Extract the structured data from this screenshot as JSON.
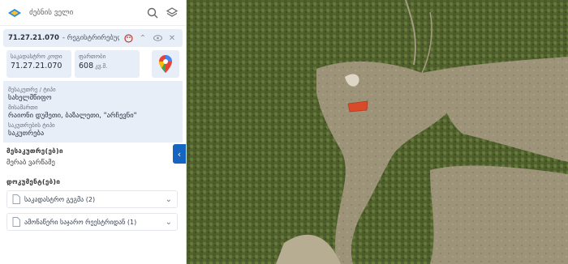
{
  "search": {
    "placeholder": "ძებნის ველი"
  },
  "parcel": {
    "code": "71.27.21.070",
    "sub": "- რეგისტრირებულია",
    "stats": {
      "cadastral_label": "საკადასტრო კოდი",
      "cadastral_value": "71.27.21.070",
      "area_label": "ფართობი",
      "area_value": "608",
      "area_unit": "კვ.მ."
    },
    "info": [
      {
        "label": "მესაკუთრე / ტიპი",
        "value": "სახელმწიფო"
      },
      {
        "label": "მისამართი",
        "value": "რაიონი დუშეთი, ბაზალეთი, \"არჩევნი\""
      },
      {
        "label": "საკუთრების ტიპი",
        "value": "საკუთრება"
      }
    ]
  },
  "owner": {
    "title": "მესაკუთრე(ებ)ი",
    "value": "მერაბ ვარწამე"
  },
  "documents": {
    "title": "დოკუმენტ(ებ)ი",
    "items": [
      {
        "label": "საკადასტრო გეგმა (2)"
      },
      {
        "label": "ამონაწერი საჯარო რეესტრიდან (1)"
      }
    ]
  },
  "colors": {
    "accent": "#1565c0",
    "parcel": "#d94a2b",
    "card": "#e7eef8"
  }
}
